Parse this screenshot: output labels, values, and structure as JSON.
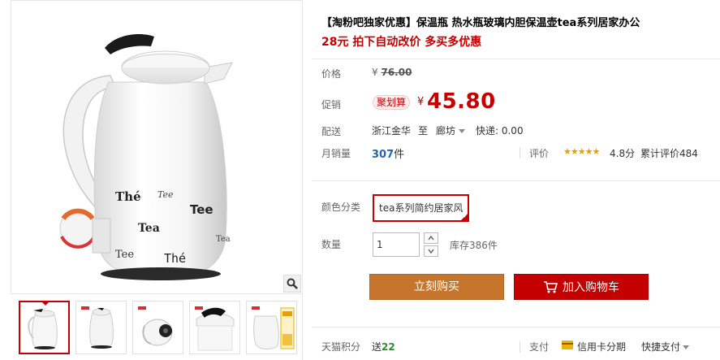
{
  "product": {
    "title": "【淘粉吧独家优惠】保温瓶 热水瓶玻璃内胆保温壶tea系列居家办公",
    "subtitle": "28元 拍下自动改价 多买多优惠"
  },
  "price": {
    "label": "价格",
    "currency": "¥",
    "original": "76.00",
    "promo_label": "促销",
    "promo_tag": "聚划算",
    "promo_currency": "¥",
    "promo_value": "45.80"
  },
  "shipping": {
    "label": "配送",
    "from": "浙江金华",
    "to_word": "至",
    "destination": "廊坊",
    "express": "快递: 0.00"
  },
  "sales": {
    "label": "月销量",
    "count": "307",
    "unit": "件",
    "rating_label": "评价",
    "stars": "★★★★★",
    "score": "4.8分",
    "cumulative": "累计评价484"
  },
  "sku": {
    "color_label": "颜色分类",
    "selected_color": "tea系列简约居家风",
    "qty_label": "数量",
    "qty_value": "1",
    "stock": "库存386件"
  },
  "actions": {
    "buy_now": "立刻购买",
    "add_cart": "加入购物车"
  },
  "footer": {
    "points_label": "天猫积分",
    "points_prefix": "送",
    "points_value": "22",
    "pay_label": "支付",
    "installment": "信用卡分期",
    "quick_pay": "快捷支付"
  },
  "product_labels": {
    "words": [
      "Thé",
      "Tee",
      "Tea",
      "Tee",
      "Thé",
      "Tee",
      "Tea"
    ]
  },
  "colors": {
    "accent_red": "#c40000",
    "buy_orange": "#c6762c",
    "link_blue": "#2266aa",
    "star_gold": "#e8a000"
  }
}
